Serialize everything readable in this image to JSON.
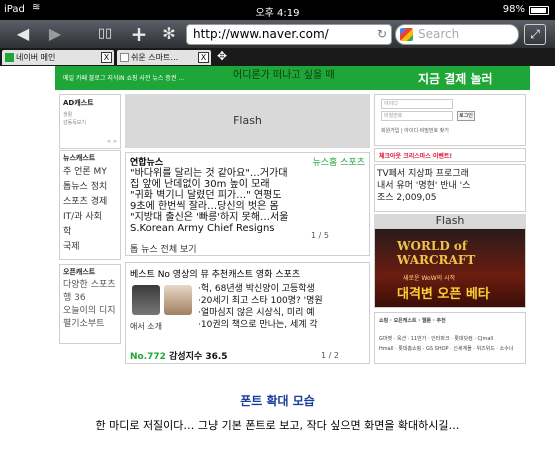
{
  "status_bar": {
    "device": "iPad",
    "wifi_icon": "wifi-icon",
    "time": "오후 4:19",
    "battery": "98%"
  },
  "toolbar": {
    "back_icon": "◀",
    "forward_icon": "▶",
    "bookmarks_icon": "📖",
    "add_icon": "+",
    "settings_icon": "✻",
    "url": "http://www.naver.com/",
    "reload_icon": "↻",
    "search_placeholder": "Search",
    "fullscreen_icon": "⤢"
  },
  "tabs": [
    {
      "label": "네이버 메인",
      "close": "X"
    },
    {
      "label": "쉬운 스마트…",
      "close": "X"
    }
  ],
  "tab_add": "✥",
  "page": {
    "menu": "메일 카페 블로그 지식iN 쇼핑  사전 뉴스 증권 …",
    "search_line": "어디론가 떠나고 싶을 때",
    "promo": "지금 결제  놀러",
    "ad_box": {
      "title": "AD캐스트",
      "lines": [
        "생활",
        "감동독보기"
      ],
      "pager": "< >"
    },
    "news_left": {
      "title": "뉴스캐스트",
      "rows": [
        "주 언론 MY",
        "톱뉴스 정치",
        "스포츠 경제",
        "IT/과 사회",
        "학",
        "국제"
      ]
    },
    "os_left": {
      "title": "오픈캐스트",
      "rows": [
        "다양한 스포츠",
        "행 36",
        "오늘이의 디지",
        "펼기소부트"
      ]
    },
    "flash_main": "Flash",
    "news_center": {
      "tab_active": "연합뉴스",
      "tabs": "뉴스홈  스포츠",
      "headlines": [
        "\"바다위를 달리는 것 같아요\"…거가대",
        "집 앞에 난데없이 30m 높이 모래",
        "\"귀화 벽기니 달렸던 피가…\" 연평도",
        "9초에 한번씩 잘라…당신의 벗은 몸",
        "\"지방대 출신은 '빠릉'하지 못해…서울",
        "S.Korean Army Chief Resigns"
      ],
      "footer": "톱 뉴스 전체 보기",
      "page": "1 / 5"
    },
    "best_center": {
      "tabs": "베스트 No  영상의 뮤 추천캐스트 영화 스포츠",
      "lines": [
        "·헉, 68년생 박신양이 고등학생",
        "·20세기 최고 스타 100명? '명원",
        "·얼마심지 않은 시상식, 미리 예",
        "·10권의 책으로 만나는, 세계 각"
      ],
      "caption": "애서 소개",
      "count": "No.772",
      "footer": "감성지수 36.5",
      "page": "1 / 2"
    },
    "login": {
      "id_placeholder": "아이디",
      "pw_placeholder": "비밀번호",
      "button": "로그인",
      "links": "회원가입 | 아이디·비밀번호 찾기"
    },
    "chrome_banner": "체크아웃 크리스마스 이벤트!",
    "tv_lines": [
      "TV페서 지상파 프로그래",
      "내서 유머 '명현' 반내 '스",
      "조스 2,009,05"
    ],
    "flash_right": "Flash",
    "wow": {
      "logo": "WORLD of WARCRAFT",
      "sub": "새로운 WoW의 시작",
      "title": "대격변 오픈 베타"
    },
    "shop_lines": [
      "쇼핑 · 오픈캐스트 · 웹툰 · 추천",
      "G마켓 · 옥션 · 11번가 · 인터파크 · 롯데닷컴 · CJmall",
      "Hmall · 롯데홈쇼핑 · GS SHOP · 신세계몰 · 위즈위드 · 소수너"
    ]
  },
  "caption": {
    "title": "폰트 확대 모습",
    "text": "한 마디로 저질이다… 그냥 기본 폰트로 보고, 작다 싶으면 화면을 확대하시길…"
  }
}
